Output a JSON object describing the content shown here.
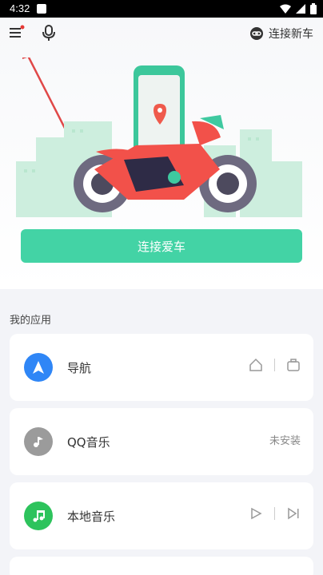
{
  "status_bar": {
    "time": "4:32"
  },
  "header": {
    "connect_new_label": "连接新车"
  },
  "main": {
    "connect_button_label": "连接爱车"
  },
  "apps": {
    "section_title": "我的应用",
    "items": [
      {
        "name": "导航"
      },
      {
        "name": "QQ音乐",
        "status": "未安装"
      },
      {
        "name": "本地音乐"
      }
    ]
  },
  "colors": {
    "accent": "#43d3a5",
    "nav_blue": "#2f86f6",
    "music_green": "#2dc35c",
    "disabled_gray": "#9b9b9b"
  }
}
